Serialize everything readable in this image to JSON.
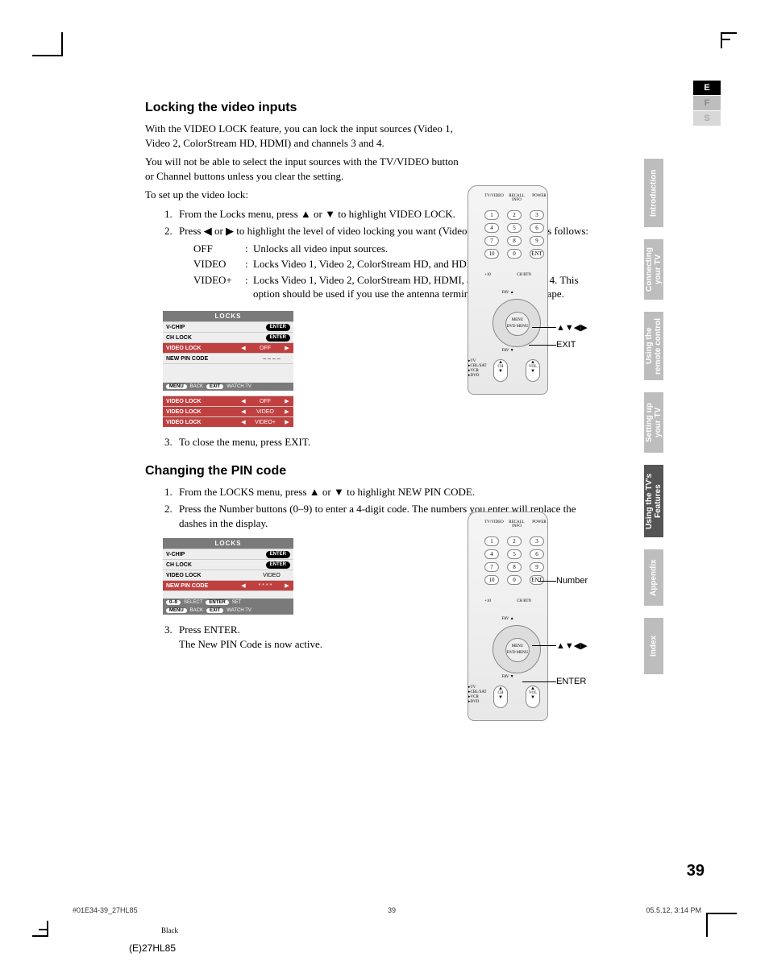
{
  "section1": {
    "title": "Locking the video inputs",
    "p1": "With the VIDEO LOCK feature, you can lock the input sources (Video 1, Video 2, ColorStream HD, HDMI) and channels 3 and 4.",
    "p2": "You will not be able to select the input sources with the TV/VIDEO button or Channel buttons unless you clear the setting.",
    "p3": "To set up the video lock:",
    "step1": "From the Locks menu, press ▲ or ▼ to highlight VIDEO LOCK.",
    "step2": "Press ◀ or ▶ to highlight the level of video locking you want (Video, Video+, or Off), as follows:",
    "def_off_t": "OFF",
    "def_off_d": "Unlocks all video input sources.",
    "def_vid_t": "VIDEO",
    "def_vid_d": "Locks Video 1, Video 2, ColorStream HD, and HDMI.",
    "def_vidp_t": "VIDEO+",
    "def_vidp_d": "Locks Video 1, Video 2, ColorStream HD, HDMI, and channels 3 and 4. This option should be used if you use the antenna terminal to play a video tape.",
    "step3": "To close the menu, press EXIT."
  },
  "menu1": {
    "header": "LOCKS",
    "r1": "V-CHIP",
    "r1v": "ENTER",
    "r2": "CH LOCK",
    "r2v": "ENTER",
    "r3": "VIDEO LOCK",
    "r3v": "OFF",
    "r4": "NEW PIN CODE",
    "r4v": "– – – –",
    "foot_back": "BACK",
    "foot_menu": "MENU",
    "foot_exit": "EXIT",
    "foot_watch": "WATCH TV",
    "opt1l": "VIDEO LOCK",
    "opt1v": "OFF",
    "opt2l": "VIDEO LOCK",
    "opt2v": "VIDEO",
    "opt3l": "VIDEO LOCK",
    "opt3v": "VIDEO+"
  },
  "section2": {
    "title": "Changing the PIN code",
    "step1": "From the LOCKS menu, press ▲ or ▼ to highlight NEW PIN CODE.",
    "step2": "Press the Number buttons (0–9) to enter a 4-digit code. The numbers you enter will replace the dashes in the display.",
    "step3a": "Press ENTER.",
    "step3b": "The New PIN Code is now active."
  },
  "menu2": {
    "header": "LOCKS",
    "r1": "V-CHIP",
    "r1v": "ENTER",
    "r2": "CH LOCK",
    "r2v": "ENTER",
    "r3": "VIDEO LOCK",
    "r3v": "VIDEO",
    "r4": "NEW PIN CODE",
    "r4v": "* * * *",
    "foot_select": "SELECT",
    "foot_09": "0–9",
    "foot_enter": "ENTER",
    "foot_set": "SET",
    "foot_menu": "MENU",
    "foot_back": "BACK",
    "foot_exit": "EXIT",
    "foot_watch": "WATCH TV"
  },
  "remote1": {
    "tvvideo": "TV/VIDEO",
    "recall": "RECALL",
    "power": "POWER",
    "info": "INFO",
    "plus10": "+10",
    "chrtn": "CH RTN",
    "ent": "ENT",
    "fav_up": "FAV ▲",
    "fav_down": "FAV ▼",
    "menu": "MENU",
    "dvdmenu": "DVD MENU",
    "ch": "CH",
    "vol": "VOL",
    "tv": "TV",
    "cblsat": "CBL/SAT",
    "vcr": "VCR",
    "dvd": "DVD",
    "callout_arrows": "▲▼◀▶",
    "callout_exit": "EXIT"
  },
  "remote2": {
    "callout_number": "Number",
    "callout_arrows": "▲▼◀▶",
    "callout_enter": "ENTER"
  },
  "tabs": {
    "e": "E",
    "f": "F",
    "s": "S",
    "intro": "Introduction",
    "conn": "Connecting your TV",
    "remote": "Using the remote control",
    "setup": "Setting up your TV",
    "features": "Using the TV's Features",
    "appx": "Appendix",
    "index": "Index"
  },
  "page_num": "39",
  "footer": {
    "left": "#01E34-39_27HL85",
    "mid": "39",
    "right": "05.5.12, 3:14 PM",
    "black": "Black",
    "code": "(E)27HL85"
  }
}
